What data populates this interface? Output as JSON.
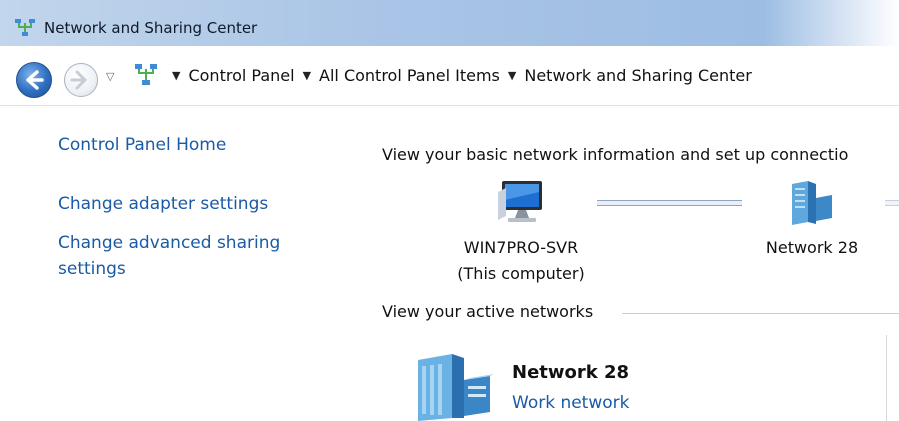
{
  "window": {
    "title": "Network and Sharing Center"
  },
  "addressbar": {
    "crumbs": [
      "Control Panel",
      "All Control Panel Items",
      "Network and Sharing Center"
    ]
  },
  "sidebar": {
    "links": [
      "Control Panel Home",
      "Change adapter settings",
      "Change advanced sharing",
      "settings"
    ]
  },
  "main": {
    "heading": "View your basic network information and set up connectio",
    "computer": {
      "name": "WIN7PRO-SVR",
      "subtitle": "(This computer)"
    },
    "network": {
      "name": "Network  28"
    },
    "active_section": "View your active networks",
    "active_network": {
      "name": "Network  28",
      "type": "Work network"
    }
  },
  "icons": {
    "window": "network-center-icon",
    "back": "back-arrow-icon",
    "forward": "forward-arrow-icon",
    "computer": "computer-icon",
    "network": "network-server-icon"
  },
  "colors": {
    "link": "#1a5aa6",
    "titlebar": "#aac5e6"
  }
}
